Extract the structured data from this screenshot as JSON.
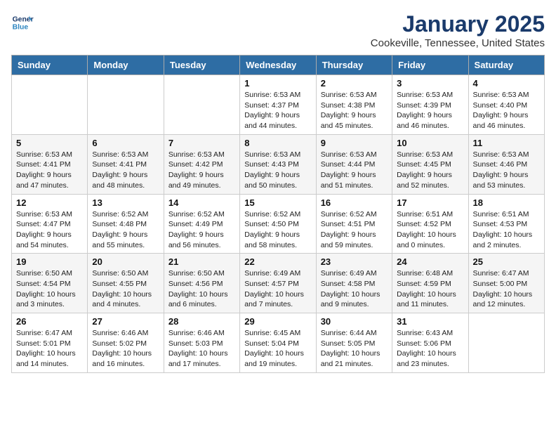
{
  "logo": {
    "line1": "General",
    "line2": "Blue"
  },
  "title": "January 2025",
  "subtitle": "Cookeville, Tennessee, United States",
  "days_of_week": [
    "Sunday",
    "Monday",
    "Tuesday",
    "Wednesday",
    "Thursday",
    "Friday",
    "Saturday"
  ],
  "weeks": [
    [
      {
        "day": "",
        "info": ""
      },
      {
        "day": "",
        "info": ""
      },
      {
        "day": "",
        "info": ""
      },
      {
        "day": "1",
        "info": "Sunrise: 6:53 AM\nSunset: 4:37 PM\nDaylight: 9 hours\nand 44 minutes."
      },
      {
        "day": "2",
        "info": "Sunrise: 6:53 AM\nSunset: 4:38 PM\nDaylight: 9 hours\nand 45 minutes."
      },
      {
        "day": "3",
        "info": "Sunrise: 6:53 AM\nSunset: 4:39 PM\nDaylight: 9 hours\nand 46 minutes."
      },
      {
        "day": "4",
        "info": "Sunrise: 6:53 AM\nSunset: 4:40 PM\nDaylight: 9 hours\nand 46 minutes."
      }
    ],
    [
      {
        "day": "5",
        "info": "Sunrise: 6:53 AM\nSunset: 4:41 PM\nDaylight: 9 hours\nand 47 minutes."
      },
      {
        "day": "6",
        "info": "Sunrise: 6:53 AM\nSunset: 4:41 PM\nDaylight: 9 hours\nand 48 minutes."
      },
      {
        "day": "7",
        "info": "Sunrise: 6:53 AM\nSunset: 4:42 PM\nDaylight: 9 hours\nand 49 minutes."
      },
      {
        "day": "8",
        "info": "Sunrise: 6:53 AM\nSunset: 4:43 PM\nDaylight: 9 hours\nand 50 minutes."
      },
      {
        "day": "9",
        "info": "Sunrise: 6:53 AM\nSunset: 4:44 PM\nDaylight: 9 hours\nand 51 minutes."
      },
      {
        "day": "10",
        "info": "Sunrise: 6:53 AM\nSunset: 4:45 PM\nDaylight: 9 hours\nand 52 minutes."
      },
      {
        "day": "11",
        "info": "Sunrise: 6:53 AM\nSunset: 4:46 PM\nDaylight: 9 hours\nand 53 minutes."
      }
    ],
    [
      {
        "day": "12",
        "info": "Sunrise: 6:53 AM\nSunset: 4:47 PM\nDaylight: 9 hours\nand 54 minutes."
      },
      {
        "day": "13",
        "info": "Sunrise: 6:52 AM\nSunset: 4:48 PM\nDaylight: 9 hours\nand 55 minutes."
      },
      {
        "day": "14",
        "info": "Sunrise: 6:52 AM\nSunset: 4:49 PM\nDaylight: 9 hours\nand 56 minutes."
      },
      {
        "day": "15",
        "info": "Sunrise: 6:52 AM\nSunset: 4:50 PM\nDaylight: 9 hours\nand 58 minutes."
      },
      {
        "day": "16",
        "info": "Sunrise: 6:52 AM\nSunset: 4:51 PM\nDaylight: 9 hours\nand 59 minutes."
      },
      {
        "day": "17",
        "info": "Sunrise: 6:51 AM\nSunset: 4:52 PM\nDaylight: 10 hours\nand 0 minutes."
      },
      {
        "day": "18",
        "info": "Sunrise: 6:51 AM\nSunset: 4:53 PM\nDaylight: 10 hours\nand 2 minutes."
      }
    ],
    [
      {
        "day": "19",
        "info": "Sunrise: 6:50 AM\nSunset: 4:54 PM\nDaylight: 10 hours\nand 3 minutes."
      },
      {
        "day": "20",
        "info": "Sunrise: 6:50 AM\nSunset: 4:55 PM\nDaylight: 10 hours\nand 4 minutes."
      },
      {
        "day": "21",
        "info": "Sunrise: 6:50 AM\nSunset: 4:56 PM\nDaylight: 10 hours\nand 6 minutes."
      },
      {
        "day": "22",
        "info": "Sunrise: 6:49 AM\nSunset: 4:57 PM\nDaylight: 10 hours\nand 7 minutes."
      },
      {
        "day": "23",
        "info": "Sunrise: 6:49 AM\nSunset: 4:58 PM\nDaylight: 10 hours\nand 9 minutes."
      },
      {
        "day": "24",
        "info": "Sunrise: 6:48 AM\nSunset: 4:59 PM\nDaylight: 10 hours\nand 11 minutes."
      },
      {
        "day": "25",
        "info": "Sunrise: 6:47 AM\nSunset: 5:00 PM\nDaylight: 10 hours\nand 12 minutes."
      }
    ],
    [
      {
        "day": "26",
        "info": "Sunrise: 6:47 AM\nSunset: 5:01 PM\nDaylight: 10 hours\nand 14 minutes."
      },
      {
        "day": "27",
        "info": "Sunrise: 6:46 AM\nSunset: 5:02 PM\nDaylight: 10 hours\nand 16 minutes."
      },
      {
        "day": "28",
        "info": "Sunrise: 6:46 AM\nSunset: 5:03 PM\nDaylight: 10 hours\nand 17 minutes."
      },
      {
        "day": "29",
        "info": "Sunrise: 6:45 AM\nSunset: 5:04 PM\nDaylight: 10 hours\nand 19 minutes."
      },
      {
        "day": "30",
        "info": "Sunrise: 6:44 AM\nSunset: 5:05 PM\nDaylight: 10 hours\nand 21 minutes."
      },
      {
        "day": "31",
        "info": "Sunrise: 6:43 AM\nSunset: 5:06 PM\nDaylight: 10 hours\nand 23 minutes."
      },
      {
        "day": "",
        "info": ""
      }
    ]
  ]
}
